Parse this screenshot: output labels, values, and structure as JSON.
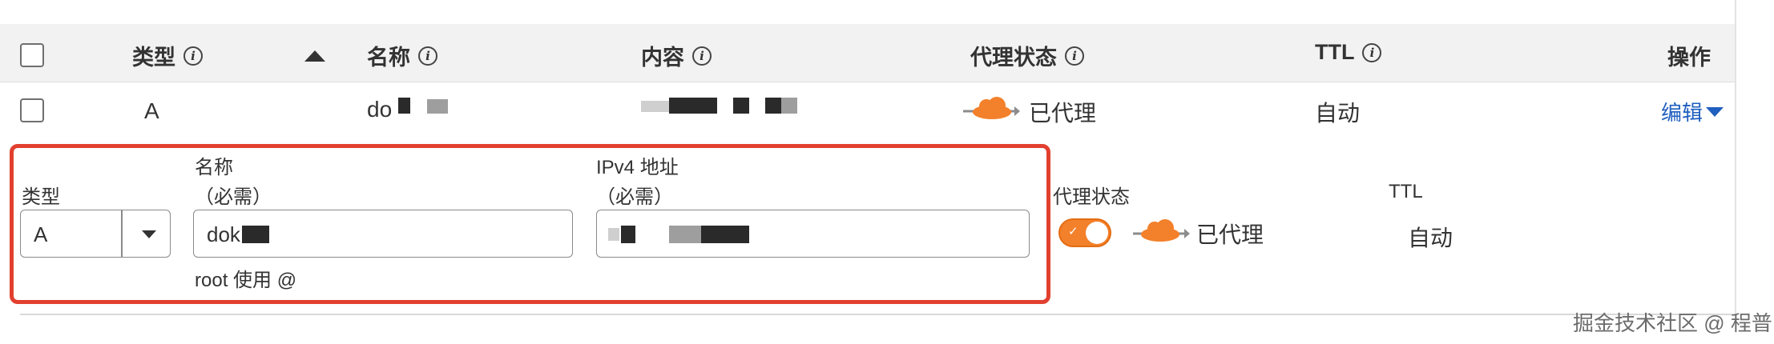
{
  "table": {
    "headers": {
      "type": "类型",
      "name": "名称",
      "content": "内容",
      "proxy_status": "代理状态",
      "ttl": "TTL",
      "actions": "操作"
    },
    "row": {
      "type": "A",
      "name": "do",
      "proxy_status": "已代理",
      "ttl": "自动",
      "edit_label": "编辑"
    }
  },
  "edit_form": {
    "type_label": "类型",
    "type_value": "A",
    "name_label": "名称",
    "name_required": "（必需）",
    "name_value": "dok",
    "name_hint": "root 使用 @",
    "ipv4_label": "IPv4 地址",
    "ipv4_required": "（必需）",
    "proxy_label": "代理状态",
    "proxy_value": "已代理",
    "proxy_enabled": true,
    "ttl_label": "TTL",
    "ttl_value": "自动"
  },
  "icons": {
    "info": "info-circle-icon",
    "sort": "sort-ascending-icon",
    "cloud": "cloudflare-proxied-cloud-icon",
    "caret": "chevron-down-icon"
  },
  "colors": {
    "accent_orange": "#f3802a",
    "highlight_red": "#e2402f",
    "link_blue": "#1f5fbf"
  },
  "watermark": "掘金技术社区 @ 程普"
}
